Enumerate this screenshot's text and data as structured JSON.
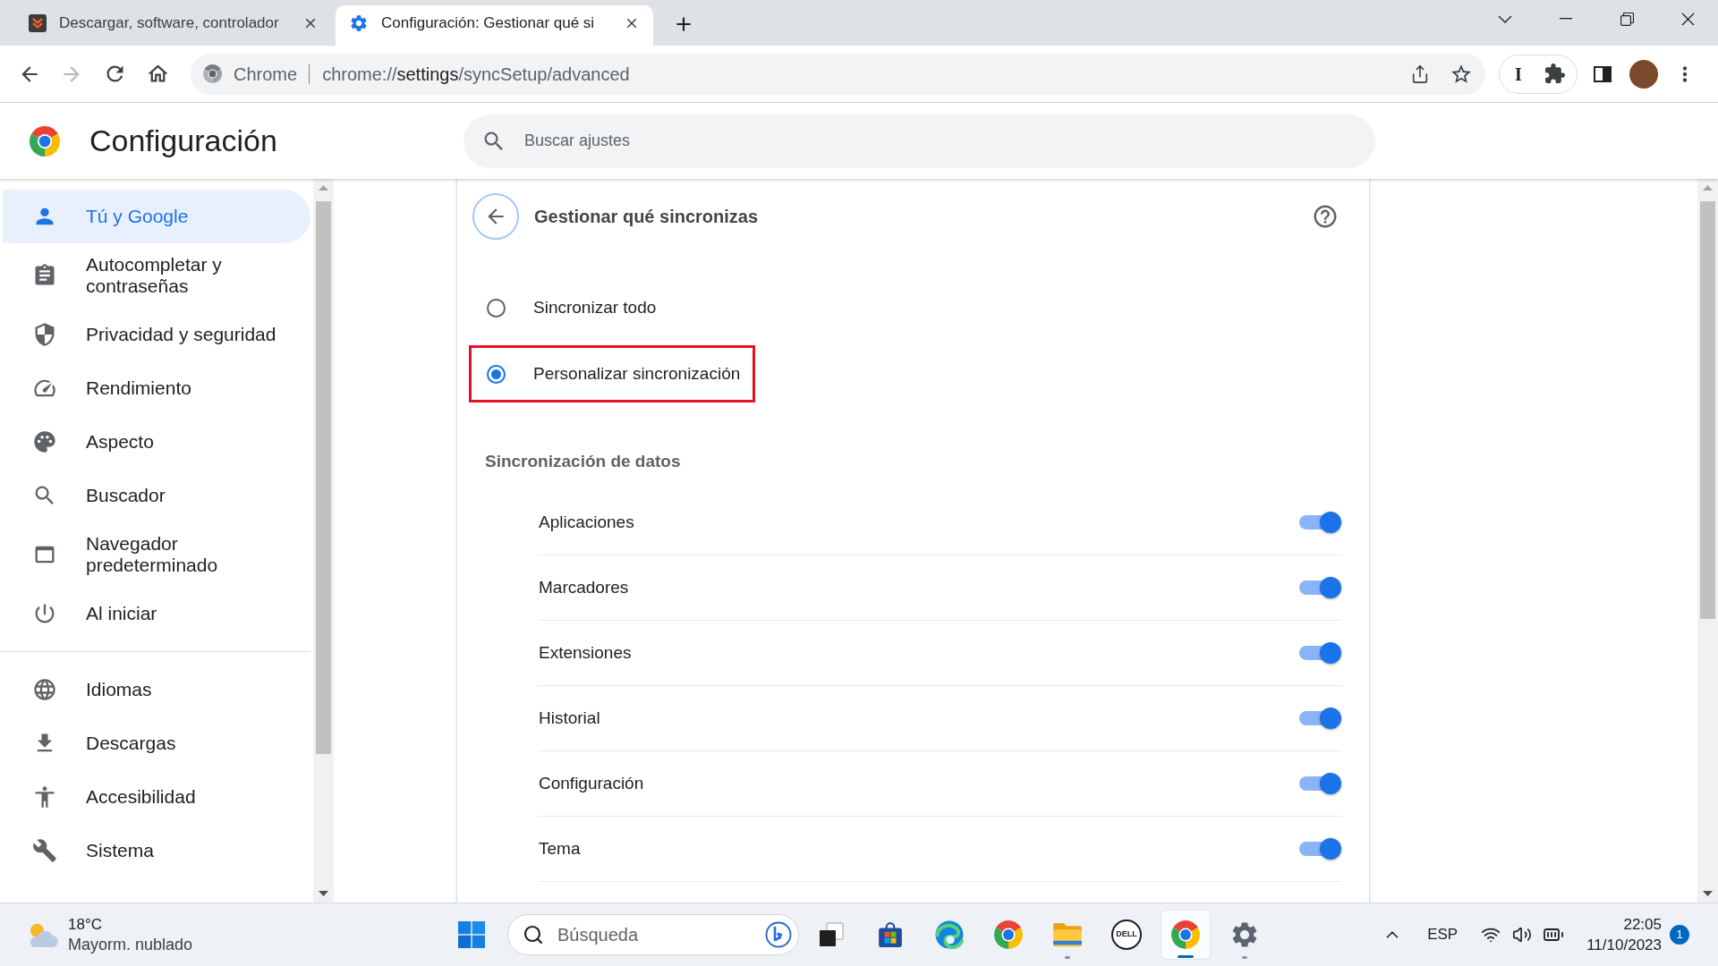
{
  "browser": {
    "tabs": [
      {
        "title": "Descargar, software, controlador",
        "selected": false
      },
      {
        "title": "Configuración: Gestionar qué si",
        "selected": true
      }
    ],
    "forward_button": {
      "disabled": true
    },
    "address_bar": {
      "site_label": "Chrome",
      "url_scheme": "chrome://",
      "url_host": "settings",
      "url_path": "/syncSetup/advanced"
    },
    "extension_label": "I"
  },
  "header": {
    "title": "Configuración",
    "search": {
      "placeholder": "Buscar ajustes"
    }
  },
  "sidebar": {
    "sections": [
      {
        "items": [
          {
            "label": "Tú y Google",
            "selected": true
          },
          {
            "label": "Autocompletar y contraseñas",
            "selected": false
          },
          {
            "label": "Privacidad y seguridad",
            "selected": false
          },
          {
            "label": "Rendimiento",
            "selected": false
          },
          {
            "label": "Aspecto",
            "selected": false
          },
          {
            "label": "Buscador",
            "selected": false
          },
          {
            "label": "Navegador predeterminado",
            "selected": false
          },
          {
            "label": "Al iniciar",
            "selected": false
          }
        ]
      },
      {
        "items": [
          {
            "label": "Idiomas",
            "selected": false
          },
          {
            "label": "Descargas",
            "selected": false
          },
          {
            "label": "Accesibilidad",
            "selected": false
          },
          {
            "label": "Sistema",
            "selected": false
          }
        ]
      }
    ]
  },
  "sync_panel": {
    "title": "Gestionar qué sincronizas",
    "options": [
      {
        "label": "Sincronizar todo",
        "selected": false,
        "highlighted": false
      },
      {
        "label": "Personalizar sincronización",
        "selected": true,
        "highlighted": true
      }
    ],
    "section_title": "Sincronización de datos",
    "data_types": [
      {
        "label": "Aplicaciones",
        "on": true
      },
      {
        "label": "Marcadores",
        "on": true
      },
      {
        "label": "Extensiones",
        "on": true
      },
      {
        "label": "Historial",
        "on": true
      },
      {
        "label": "Configuración",
        "on": true
      },
      {
        "label": "Tema",
        "on": true
      }
    ]
  },
  "taskbar": {
    "weather": {
      "temperature": "18°C",
      "condition": "Mayorm. nublado"
    },
    "search": {
      "placeholder": "Búsqueda"
    },
    "apps": [
      {
        "running": false,
        "selected": false
      },
      {
        "running": false,
        "selected": false
      },
      {
        "running": false,
        "selected": false
      },
      {
        "running": false,
        "selected": false
      },
      {
        "running": true,
        "selected": false
      },
      {
        "label": "DELL",
        "running": false,
        "selected": false
      },
      {
        "running": true,
        "selected": true
      },
      {
        "running": true,
        "selected": false
      }
    ],
    "tray": {
      "language": "ESP",
      "time": "22:05",
      "date": "11/10/2023",
      "notification_count": "1"
    }
  }
}
